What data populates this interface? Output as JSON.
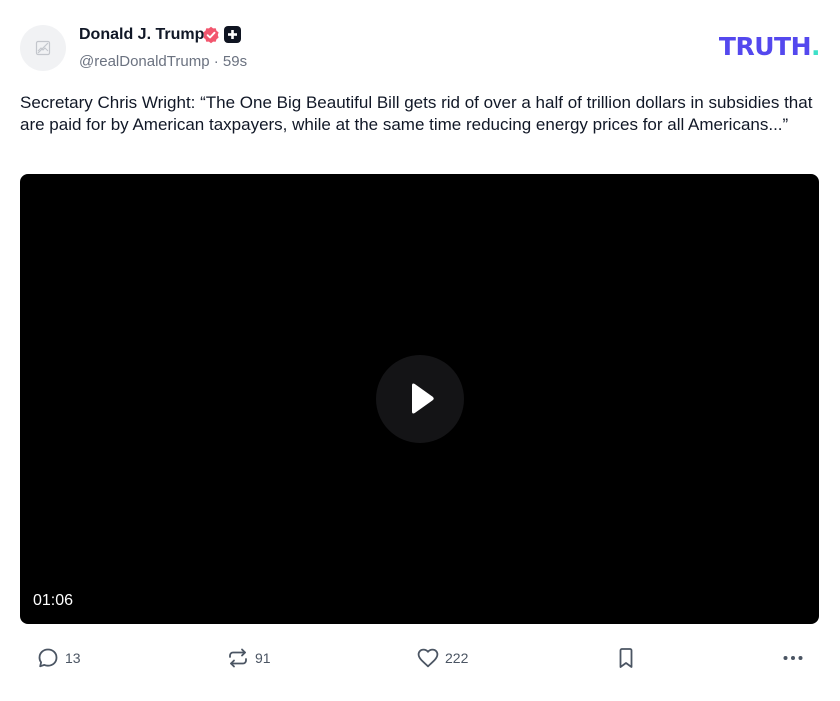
{
  "author": {
    "name": "Donald J. Trump",
    "handle": "@realDonaldTrump",
    "separator": "·",
    "time": "59s"
  },
  "brand": {
    "logo_text": "TRUTH",
    "logo_dot": ".",
    "primary_color": "#5448ee",
    "accent_color": "#3ee0c8"
  },
  "post": {
    "text": "Secretary Chris Wright: “The One Big Beautiful Bill gets rid of over a half of trillion dollars in subsidies that are paid for by American taxpayers, while at the same time reducing energy prices for all Americans...”"
  },
  "video": {
    "duration": "01:06",
    "icon": "play-icon"
  },
  "actions": {
    "replies": "13",
    "retruths": "91",
    "likes": "222",
    "icons": [
      "reply-icon",
      "retruth-icon",
      "like-icon",
      "bookmark-icon",
      "more-icon"
    ]
  },
  "colors": {
    "verified_badge": "#f2566e",
    "text": "#111827",
    "muted": "#6b7280"
  }
}
